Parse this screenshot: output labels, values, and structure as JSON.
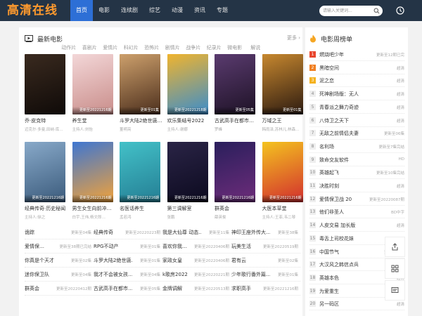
{
  "header": {
    "logo": "高清在线",
    "nav": [
      "首页",
      "电影",
      "连续剧",
      "综艺",
      "动漫",
      "资讯",
      "专题"
    ],
    "search_placeholder": "请输入关键词..."
  },
  "main": {
    "title": "最新电影",
    "more": "更多 ›",
    "genres": [
      "动作片",
      "喜剧片",
      "爱情片",
      "科幻片",
      "恐怖片",
      "剧情片",
      "战争片",
      "纪录片",
      "微电影",
      "解说"
    ],
    "posters": [
      {
        "title": "乔·皮克特",
        "sub": "迈克尔·多曼,田纳·库…",
        "badge": "",
        "c1": "#3a2a1f",
        "c2": "#0f0a08"
      },
      {
        "title": "养生堂",
        "sub": "主持人:刘怡",
        "badge": "更新至20221216期",
        "c1": "#f3d7d8",
        "c2": "#c98d8a"
      },
      {
        "title": "斗罗大陆2绝世唐…",
        "sub": "董明亮",
        "badge": "更新至01集",
        "c1": "#cda06c",
        "c2": "#4b2e1c"
      },
      {
        "title": "欢乐集结号2022",
        "sub": "主持人:谢娜",
        "badge": "更新至20221218期",
        "c1": "#f0b42e",
        "c2": "#3b8dcb"
      },
      {
        "title": "古武高手在都市…",
        "sub": "罗峰",
        "badge": "更新至05集",
        "c1": "#5a3b6f",
        "c2": "#1e1226"
      },
      {
        "title": "万域之王",
        "sub": "韩雨泽,苏林儿,林森…",
        "badge": "更新至01集",
        "c1": "#c7882f",
        "c2": "#2c1a10"
      },
      {
        "title": "经典传奇·历史秘闻",
        "sub": "主持人:徐之",
        "badge": "更新至20221216期",
        "c1": "#88a9c9",
        "c2": "#3b5b7c"
      },
      {
        "title": "男生女生向前冲…",
        "sub": "白宇,王伟,杨文郎…",
        "badge": "更新至20221216期",
        "c1": "#3e76d1",
        "c2": "#f1a23a"
      },
      {
        "title": "名医话养生",
        "sub": "孟若鸿",
        "badge": "更新至20221216期",
        "c1": "#43c1c8",
        "c2": "#247e94"
      },
      {
        "title": "第三调解室",
        "sub": "张鹏",
        "badge": "更新至20221216期",
        "c1": "#2a2446",
        "c2": "#0c0a1f"
      },
      {
        "title": "群英会",
        "sub": "薛英俊",
        "badge": "更新至20221216期",
        "c1": "#2a1f5c",
        "c2": "#6d2c7a"
      },
      {
        "title": "大医本草堂",
        "sub": "主持人:王菲,韦二琴",
        "badge": "更新至20221216期",
        "c1": "#f4c31f",
        "c2": "#d22e2e"
      }
    ],
    "list": [
      [
        {
          "name": "诡踪",
          "status": "更新至04集"
        },
        {
          "name": "经典传奇",
          "status": "更新至20220223期"
        },
        {
          "name": "我是大仙尊 动态…",
          "status": "更新至11集"
        },
        {
          "name": "神印王座外传大…",
          "status": "更新至38集"
        }
      ],
      [
        {
          "name": "爱情保…",
          "status": "更新至38期已完结"
        },
        {
          "name": "RPG不动产",
          "status": "更新至01集"
        },
        {
          "name": "喜欢你我…",
          "status": "更新至20220406期"
        },
        {
          "name": "玩美生活",
          "status": "更新至20220519期"
        }
      ],
      [
        {
          "name": "你真是个天才",
          "status": "更新至02集"
        },
        {
          "name": "斗罗大陆2绝世唐…",
          "status": "更新至01集"
        },
        {
          "name": "家政女皇",
          "status": "更新至20220406期"
        },
        {
          "name": "君有云",
          "status": "更新至02集"
        }
      ],
      [
        {
          "name": "迷你保卫队",
          "status": "更新至04集"
        },
        {
          "name": "我才不会被女孩…",
          "status": "更新至04集"
        },
        {
          "name": "k歌房2022",
          "status": "更新至20220221期"
        },
        {
          "name": "少年歌行番外篇…",
          "status": "更新至01集"
        }
      ],
      [
        {
          "name": "群英会",
          "status": "更新至20220412期"
        },
        {
          "name": "古武高手在都市…",
          "status": "更新至05集"
        },
        {
          "name": "金牌调解",
          "status": "更新至20220513期"
        },
        {
          "name": "求职高手",
          "status": "更新至20221216期"
        }
      ]
    ]
  },
  "rank": {
    "title": "电影周榜单",
    "items": [
      {
        "num": "1",
        "name": "燃烧吧少年",
        "status": "更新至12期已完",
        "color": "#e8462e"
      },
      {
        "num": "2",
        "name": "黑暗空间",
        "status": "超清",
        "color": "#f07f22"
      },
      {
        "num": "3",
        "name": "泥之恋",
        "status": "超清",
        "color": "#f5b21f"
      },
      {
        "num": "4",
        "name": "死神剧场版：无人",
        "status": "超清",
        "color": ""
      },
      {
        "num": "5",
        "name": "青春派之舞力奇迹",
        "status": "超清",
        "color": ""
      },
      {
        "num": "6",
        "name": "八侍卫之天下",
        "status": "超清",
        "color": ""
      },
      {
        "num": "7",
        "name": "无敌之前情侣夫妻",
        "status": "更新至06集",
        "color": ""
      },
      {
        "num": "8",
        "name": "名利场",
        "status": "更新至7集完结",
        "color": ""
      },
      {
        "num": "9",
        "name": "致命交友软件",
        "status": "HD",
        "color": ""
      },
      {
        "num": "10",
        "name": "英雄起飞",
        "status": "更新至10集完结",
        "color": ""
      },
      {
        "num": "11",
        "name": "决胜时刻",
        "status": "超清",
        "color": ""
      },
      {
        "num": "12",
        "name": "爱情保卫战 20",
        "status": "更新至20220087期",
        "color": ""
      },
      {
        "num": "13",
        "name": "他们非圣人",
        "status": "BD中字",
        "color": ""
      },
      {
        "num": "14",
        "name": "人皮交易 加长版",
        "status": "超清",
        "color": ""
      },
      {
        "num": "15",
        "name": "毒舌上司校花妹",
        "status": "超清",
        "color": ""
      },
      {
        "num": "16",
        "name": "中国节气",
        "status": "更新至01集",
        "color": ""
      },
      {
        "num": "17",
        "name": "大汉风之韩信点兵",
        "status": "超清",
        "color": ""
      },
      {
        "num": "18",
        "name": "英雄本色",
        "status": "超清",
        "color": ""
      },
      {
        "num": "19",
        "name": "为爱重生",
        "status": "超清",
        "color": ""
      },
      {
        "num": "20",
        "name": "另一码区",
        "status": "超清",
        "color": ""
      }
    ]
  },
  "icons": {
    "search": "search-icon",
    "clock": "clock-icon",
    "film": "film-icon",
    "fire": "fire-icon",
    "share": "share-icon",
    "grid": "grid-icon",
    "message": "message-icon"
  },
  "colors": {
    "header_bg": "#243446",
    "accent": "#2d6fd6",
    "logo": "#ff9a2e"
  }
}
